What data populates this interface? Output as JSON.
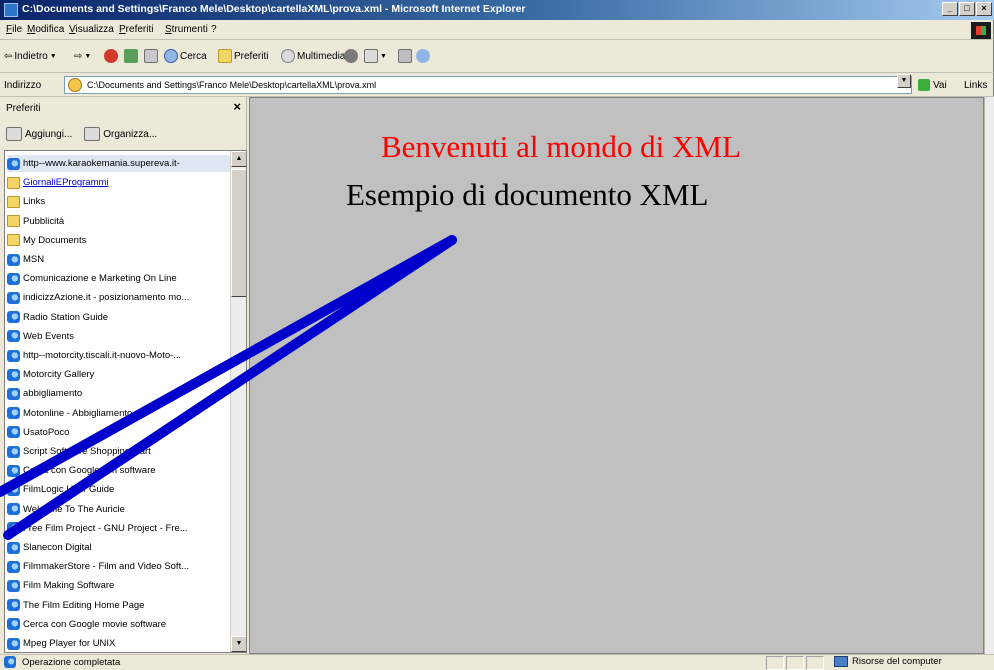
{
  "window": {
    "title": "C:\\Documents and Settings\\Franco Mele\\Desktop\\cartellaXML\\prova.xml - Microsoft Internet Explorer",
    "buttons": [
      "_",
      "□",
      "×"
    ]
  },
  "menu": [
    "File",
    "Modifica",
    "Visualizza",
    "Preferiti",
    "Strumenti",
    "?"
  ],
  "toolbar": {
    "back_label": "Indietro",
    "search_label": "Cerca",
    "favorites_label": "Preferiti",
    "media_label": "Multimedia"
  },
  "address": {
    "label": "Indirizzo",
    "value": "C:\\Documents and Settings\\Franco Mele\\Desktop\\cartellaXML\\prova.xml",
    "go_label": "Vai",
    "links_label": "Links"
  },
  "favorites": {
    "title": "Preferiti",
    "close": "×",
    "add_label": "Aggiungi...",
    "organize_label": "Organizza...",
    "items": [
      {
        "label": "http--www.karaokemania.supereva.it-",
        "icon": "ie"
      },
      {
        "label": "GiornaliEProgrammi",
        "icon": "folder",
        "link": true
      },
      {
        "label": "Links",
        "icon": "folder"
      },
      {
        "label": "Pubblicità",
        "icon": "folder"
      },
      {
        "label": "My Documents",
        "icon": "folder"
      },
      {
        "label": "MSN",
        "icon": "ie"
      },
      {
        "label": "Comunicazione e Marketing On Line",
        "icon": "ie"
      },
      {
        "label": "indicizzAzione.it - posizionamento mo...",
        "icon": "ie"
      },
      {
        "label": "Radio Station Guide",
        "icon": "ie"
      },
      {
        "label": "Web Events",
        "icon": "ie"
      },
      {
        "label": "http--motorcity.tiscali.it-nuovo-Moto-...",
        "icon": "ie"
      },
      {
        "label": "Motorcity Gallery",
        "icon": "ie"
      },
      {
        "label": "abbigliamento",
        "icon": "ie"
      },
      {
        "label": "Motonline - Abbigliamento",
        "icon": "ie"
      },
      {
        "label": "UsatoPoco",
        "icon": "ie"
      },
      {
        "label": "Script Software Shopping Cart",
        "icon": "ie"
      },
      {
        "label": "Cerca con Google film software",
        "icon": "ie"
      },
      {
        "label": "FilmLogic User Guide",
        "icon": "ie"
      },
      {
        "label": "Welcome To The Auricle",
        "icon": "ie"
      },
      {
        "label": "Free Film Project - GNU Project - Fre...",
        "icon": "ie"
      },
      {
        "label": "Slanecon Digital",
        "icon": "ie"
      },
      {
        "label": "FilmmakerStore - Film and Video Soft...",
        "icon": "ie"
      },
      {
        "label": "Film Making Software",
        "icon": "ie"
      },
      {
        "label": "The Film Editing Home Page",
        "icon": "ie"
      },
      {
        "label": "Cerca con Google movie software",
        "icon": "ie"
      },
      {
        "label": "Mpeg Player for UNIX",
        "icon": "ie"
      }
    ]
  },
  "document": {
    "heading1": "Benvenuti al mondo di XML",
    "heading2": "Esempio di documento XML",
    "heading1_color": "#ff0000"
  },
  "status": {
    "text": "Operazione completata",
    "zone": "Risorse del computer"
  },
  "annotation": {
    "color": "#0000cc"
  }
}
